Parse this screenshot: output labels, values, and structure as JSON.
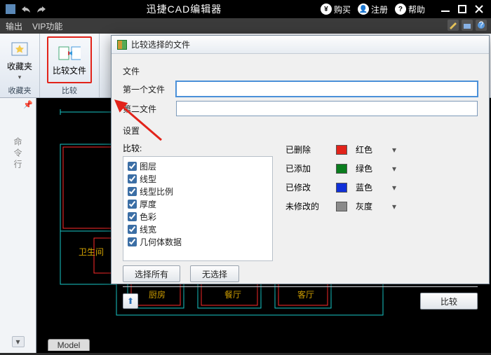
{
  "title": "迅捷CAD编辑器",
  "titlebar_right": {
    "buy": "购买",
    "register": "注册",
    "help": "帮助"
  },
  "tabs": {
    "output": "输出",
    "vip": "VIP功能"
  },
  "ribbon": {
    "favorites": {
      "big": "收藏夹",
      "group": "收藏夹"
    },
    "compare": {
      "big": "比较文件",
      "group": "比较"
    }
  },
  "vpanel_label": "命令行",
  "model_tab": "Model",
  "dialog": {
    "title": "比较选择的文件",
    "section_files": "文件",
    "file1_label": "第一个文件",
    "file2_label": "第二文件",
    "section_settings": "设置",
    "compare_label": "比较:",
    "checks": [
      "图层",
      "线型",
      "线型比例",
      "厚度",
      "色彩",
      "线宽",
      "几何体数据"
    ],
    "btn_select_all": "选择所有",
    "btn_select_none": "无选择",
    "colors": [
      {
        "label": "已删除",
        "hex": "#e2231a",
        "name": "红色"
      },
      {
        "label": "已添加",
        "hex": "#0a7d1e",
        "name": "绿色"
      },
      {
        "label": "已修改",
        "hex": "#1030d8",
        "name": "蓝色"
      },
      {
        "label": "未修改的",
        "hex": "#8a8a8a",
        "name": "灰度"
      }
    ],
    "btn_compare": "比较"
  }
}
